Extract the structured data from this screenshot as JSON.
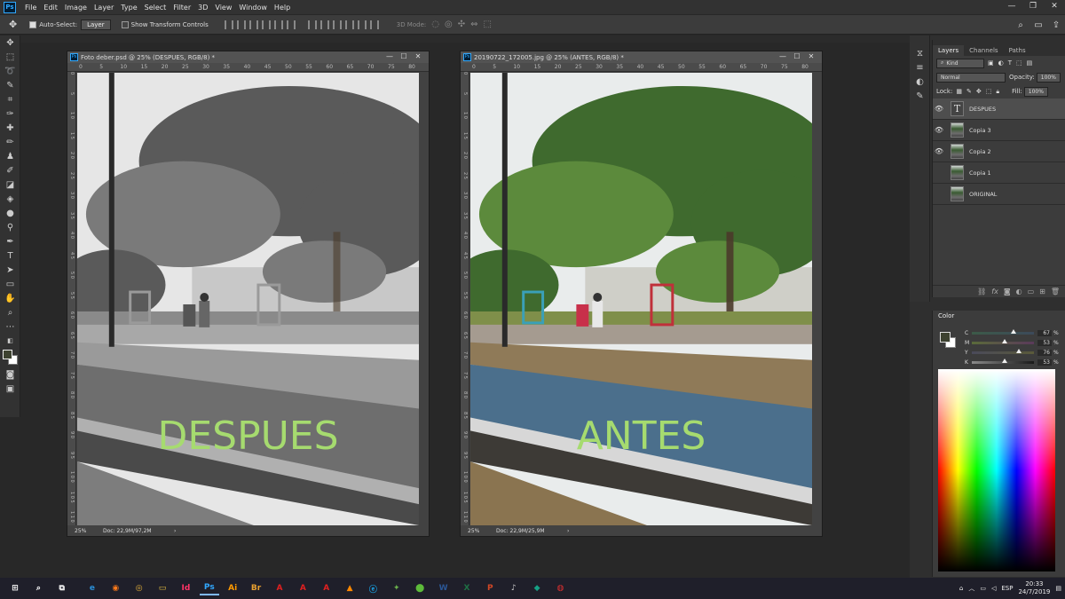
{
  "menubar": {
    "logo": "Ps",
    "items": [
      "File",
      "Edit",
      "Image",
      "Layer",
      "Type",
      "Select",
      "Filter",
      "3D",
      "View",
      "Window",
      "Help"
    ]
  },
  "window_controls": {
    "minimize": "—",
    "restore": "❐",
    "close": "✕"
  },
  "options": {
    "auto_select_label": "Auto-Select:",
    "auto_select_value": "Layer",
    "show_transform_label": "Show Transform Controls",
    "mode_3d_label": "3D Mode:"
  },
  "documents": [
    {
      "title": "Foto deber.psd @ 25% (DESPUES, RGB/8) *",
      "zoom": "25%",
      "docinfo": "Doc: 22,9M/97,2M",
      "label": "DESPUES",
      "grayscale": true,
      "ruler_h": [
        "0",
        "5",
        "10",
        "15",
        "20",
        "25",
        "30",
        "35",
        "40",
        "45",
        "50",
        "55",
        "60",
        "65",
        "70",
        "75",
        "80"
      ],
      "ruler_v": [
        "0",
        "5",
        "1 0",
        "1 5",
        "2 0",
        "2 5",
        "3 0",
        "3 5",
        "4 0",
        "4 5",
        "5 0",
        "5 5",
        "6 0",
        "6 5",
        "7 0",
        "7 5",
        "8 0",
        "8 5",
        "9 0",
        "9 5",
        "1 0 0",
        "1 0 5",
        "1 1 0"
      ]
    },
    {
      "title": "20190722_172005.jpg @ 25% (ANTES, RGB/8) *",
      "zoom": "25%",
      "docinfo": "Doc: 22,9M/25,9M",
      "label": "ANTES",
      "grayscale": false,
      "ruler_h": [
        "0",
        "5",
        "10",
        "15",
        "20",
        "25",
        "30",
        "35",
        "40",
        "45",
        "50",
        "55",
        "60",
        "65",
        "70",
        "75",
        "80"
      ],
      "ruler_v": [
        "0",
        "5",
        "1 0",
        "1 5",
        "2 0",
        "2 5",
        "3 0",
        "3 5",
        "4 0",
        "4 5",
        "5 0",
        "5 5",
        "6 0",
        "6 5",
        "7 0",
        "7 5",
        "8 0",
        "8 5",
        "9 0",
        "9 5",
        "1 0 0",
        "1 0 5",
        "1 1 0"
      ]
    }
  ],
  "layers_panel": {
    "tabs": [
      "Layers",
      "Channels",
      "Paths"
    ],
    "filter_kind": "Kind",
    "blend_mode": "Normal",
    "opacity_label": "Opacity:",
    "opacity_value": "100%",
    "lock_label": "Lock:",
    "fill_label": "Fill:",
    "fill_value": "100%",
    "layers": [
      {
        "name": "DESPUES",
        "visible": true,
        "type": "text",
        "selected": true
      },
      {
        "name": "Copia 3",
        "visible": true,
        "type": "image",
        "selected": false
      },
      {
        "name": "Copia 2",
        "visible": true,
        "type": "image",
        "selected": false
      },
      {
        "name": "Copia 1",
        "visible": false,
        "type": "image",
        "selected": false
      },
      {
        "name": "ORIGINAL",
        "visible": false,
        "type": "image",
        "selected": false
      }
    ]
  },
  "color_panel": {
    "title": "Color",
    "rows": [
      {
        "label": "C",
        "value": "67",
        "unit": "%"
      },
      {
        "label": "M",
        "value": "53",
        "unit": "%"
      },
      {
        "label": "Y",
        "value": "76",
        "unit": "%"
      },
      {
        "label": "K",
        "value": "53",
        "unit": "%"
      }
    ],
    "foreground": "#3d4230",
    "background": "#ffffff"
  },
  "taskbar": {
    "apps": [
      "⊞",
      "⌕",
      "⧉",
      "e",
      "◉",
      "◎",
      "▭",
      "Id",
      "Ps",
      "Ai",
      "Br",
      "A",
      "A",
      "A",
      "▲",
      "ⓔ",
      "✦",
      "⬤",
      "W",
      "X",
      "P",
      "♪",
      "◆",
      "◍"
    ],
    "language": "ESP",
    "time": "20:33",
    "date": "24/7/2019"
  }
}
